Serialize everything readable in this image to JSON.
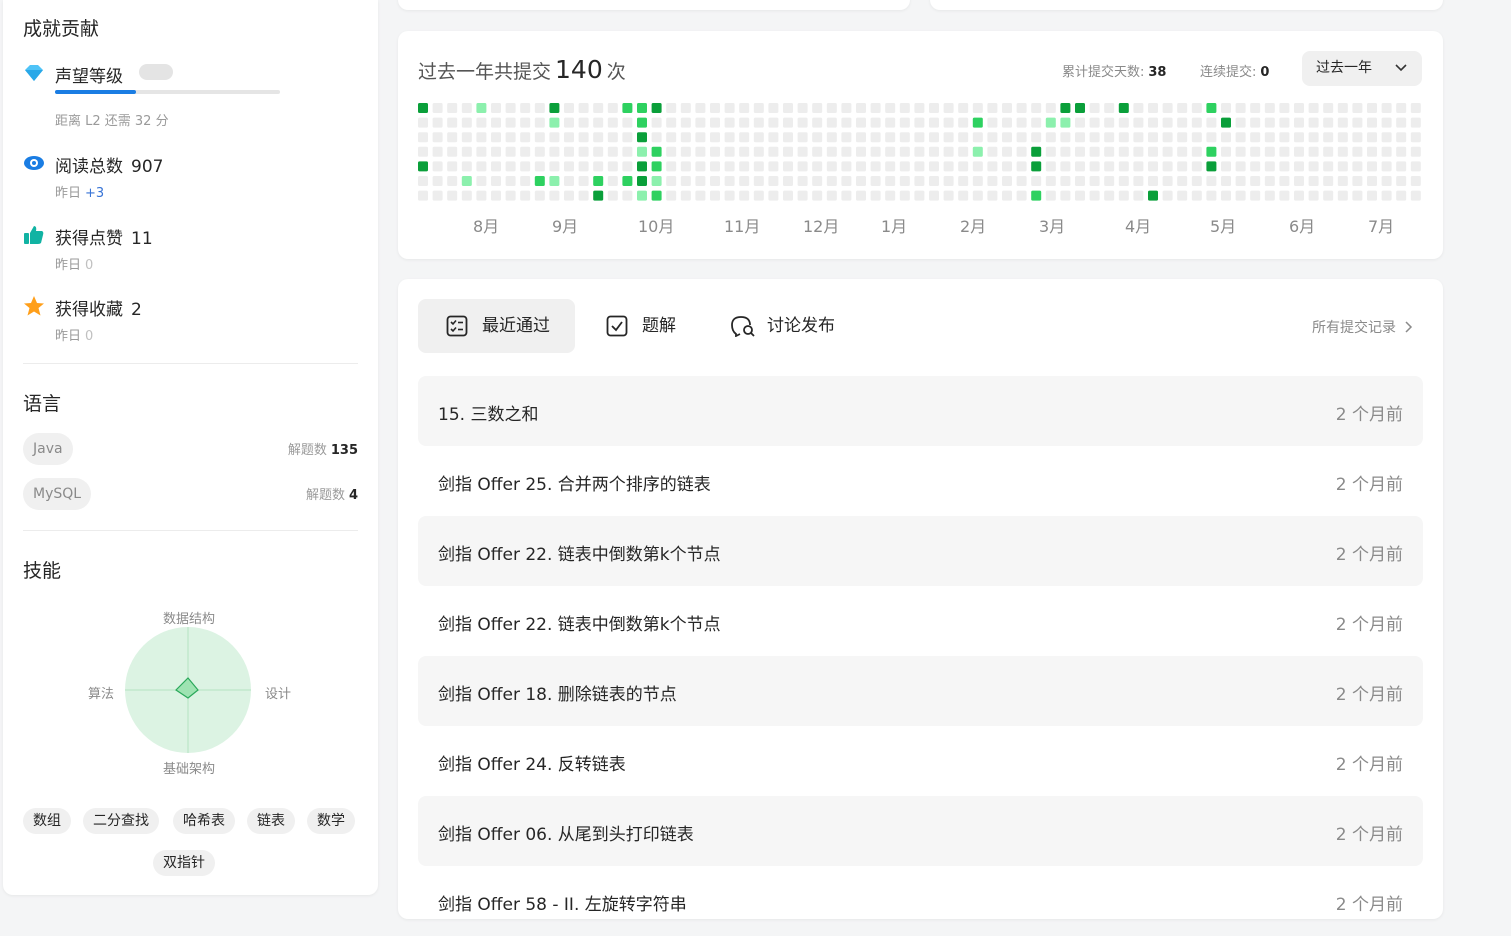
{
  "achievements": {
    "title": "成就贡献",
    "reputation": {
      "label": "声望等级",
      "progress_note": "距离 L2 还需 32 分",
      "progress": 0.36
    },
    "reads": {
      "label": "阅读总数",
      "value": "907",
      "yesterday_label": "昨日",
      "yesterday_value": "+3"
    },
    "likes": {
      "label": "获得点赞",
      "value": "11",
      "yesterday_label": "昨日",
      "yesterday_value": "0"
    },
    "favorites": {
      "label": "获得收藏",
      "value": "2",
      "yesterday_label": "昨日",
      "yesterday_value": "0"
    }
  },
  "languages": {
    "title": "语言",
    "items": [
      {
        "name": "Java",
        "stat_label": "解题数",
        "count": "135"
      },
      {
        "name": "MySQL",
        "stat_label": "解题数",
        "count": "4"
      }
    ]
  },
  "skills": {
    "title": "技能",
    "radar_axes": [
      "数据结构",
      "设计",
      "基础架构",
      "算法"
    ],
    "tags": [
      "数组",
      "二分查找",
      "哈希表",
      "链表",
      "数学",
      "双指针"
    ]
  },
  "heatmap": {
    "title_prefix": "过去一年共提交",
    "total": "140",
    "title_suffix": "次",
    "days_label": "累计提交天数:",
    "days_value": "38",
    "streak_label": "连续提交:",
    "streak_value": "0",
    "period": "过去一年",
    "months": [
      "8月",
      "9月",
      "10月",
      "11月",
      "12月",
      "1月",
      "2月",
      "3月",
      "4月",
      "5月",
      "6月",
      "7月"
    ]
  },
  "tabs": {
    "recent": "最近通过",
    "solutions": "题解",
    "discussions": "讨论发布",
    "all_records": "所有提交记录"
  },
  "submissions": [
    {
      "title": "15. 三数之和",
      "time": "2 个月前"
    },
    {
      "title": "剑指 Offer 25. 合并两个排序的链表",
      "time": "2 个月前"
    },
    {
      "title": "剑指 Offer 22. 链表中倒数第k个节点",
      "time": "2 个月前"
    },
    {
      "title": "剑指 Offer 22. 链表中倒数第k个节点",
      "time": "2 个月前"
    },
    {
      "title": "剑指 Offer 18. 删除链表的节点",
      "time": "2 个月前"
    },
    {
      "title": "剑指 Offer 24. 反转链表",
      "time": "2 个月前"
    },
    {
      "title": "剑指 Offer 06. 从尾到头打印链表",
      "time": "2 个月前"
    },
    {
      "title": "剑指 Offer 58 - II. 左旋转字符串",
      "time": "2 个月前"
    }
  ],
  "colors": {
    "accent": "#1a7de3",
    "green_dark": "#0a9f3a",
    "green_mid": "#2ed160",
    "green_light": "#8cf0ad",
    "cell_empty": "#ededed"
  }
}
